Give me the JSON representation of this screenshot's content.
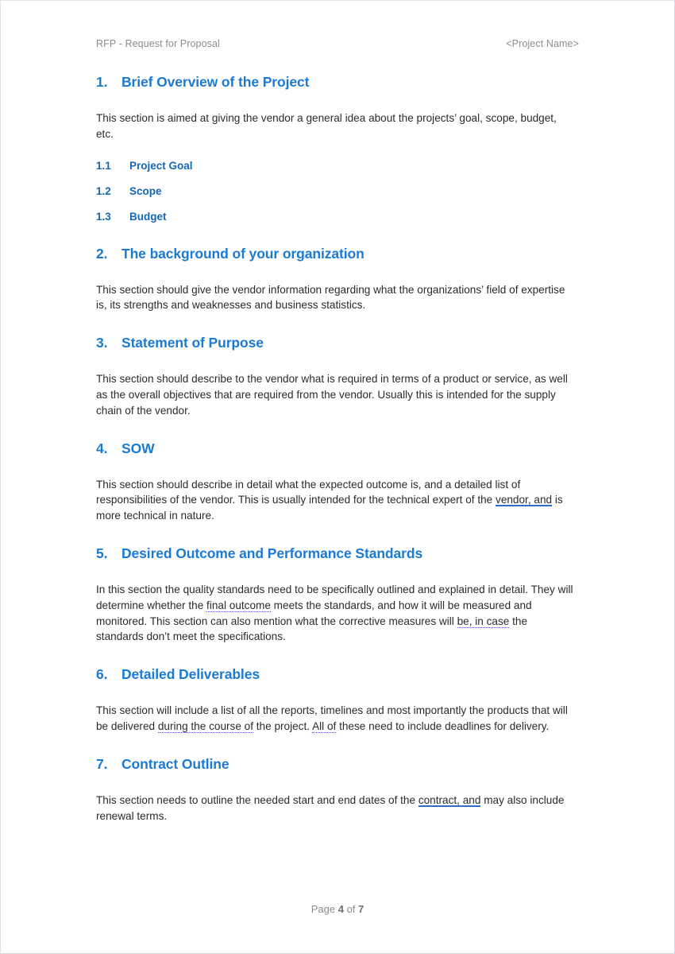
{
  "header": {
    "left": "RFP - Request for Proposal",
    "right": "<Project Name>"
  },
  "colors": {
    "heading_blue": "#1a7ad4",
    "subheading_blue": "#1667b5",
    "body_text": "#2b2b2b",
    "header_footer_gray": "#8d8d8d",
    "grammar_double_underline": "#2f6fc4",
    "grammar_dotted_underline": "#5b54c8",
    "page_border": "#d8d6e0"
  },
  "sections": [
    {
      "number": "1.",
      "title": "Brief Overview of the Project",
      "paragraph": "This section is aimed at giving the vendor a general idea about the projects’ goal, scope, budget, etc.",
      "subsections": [
        {
          "number": "1.1",
          "title": "Project Goal"
        },
        {
          "number": "1.2",
          "title": "Scope"
        },
        {
          "number": "1.3",
          "title": "Budget"
        }
      ]
    },
    {
      "number": "2.",
      "title": "The background of your organization",
      "paragraph": "This section should give the vendor information regarding what the organizations’ field of expertise is, its strengths and weaknesses and business statistics."
    },
    {
      "number": "3.",
      "title": "Statement of Purpose",
      "paragraph": "This section should describe to the vendor what is required in terms of a product or service, as well as the overall objectives that are required from the vendor. Usually this is intended for the supply chain of the vendor."
    },
    {
      "number": "4.",
      "title": "SOW",
      "paragraph_parts": [
        {
          "text": "This section should describe in detail what the expected outcome is, and a detailed list of responsibilities of the vendor. This is usually intended for the technical expert of the ",
          "mark": "none"
        },
        {
          "text": "vendor, and",
          "mark": "double-underline"
        },
        {
          "text": " is more technical in nature.",
          "mark": "none"
        }
      ]
    },
    {
      "number": "5.",
      "title": "Desired Outcome and Performance Standards",
      "paragraph_parts": [
        {
          "text": "In this section the quality standards need to be specifically outlined and explained in detail. They will determine whether the ",
          "mark": "none"
        },
        {
          "text": "final outcome",
          "mark": "dotted-underline"
        },
        {
          "text": " meets the standards, and how it will be measured and monitored. This section can also mention what the corrective measures will ",
          "mark": "none"
        },
        {
          "text": "be, in case",
          "mark": "dotted-underline"
        },
        {
          "text": " the standards don’t meet the specifications.",
          "mark": "none"
        }
      ]
    },
    {
      "number": "6.",
      "title": "Detailed Deliverables",
      "paragraph_parts": [
        {
          "text": "This section will include a list of all the reports, timelines and most importantly the products that will be delivered ",
          "mark": "none"
        },
        {
          "text": "during the course of",
          "mark": "dotted-underline"
        },
        {
          "text": " the project. ",
          "mark": "none"
        },
        {
          "text": "All of",
          "mark": "dotted-underline"
        },
        {
          "text": " these need to include deadlines for delivery.",
          "mark": "none"
        }
      ]
    },
    {
      "number": "7.",
      "title": "Contract Outline",
      "paragraph_parts": [
        {
          "text": "This section needs to outline the needed start and end dates of the ",
          "mark": "none"
        },
        {
          "text": "contract, and",
          "mark": "double-underline"
        },
        {
          "text": " may also include renewal terms.",
          "mark": "none"
        }
      ]
    }
  ],
  "footer": {
    "prefix": "Page ",
    "current_page": "4",
    "middle": " of ",
    "total_pages": "7"
  }
}
